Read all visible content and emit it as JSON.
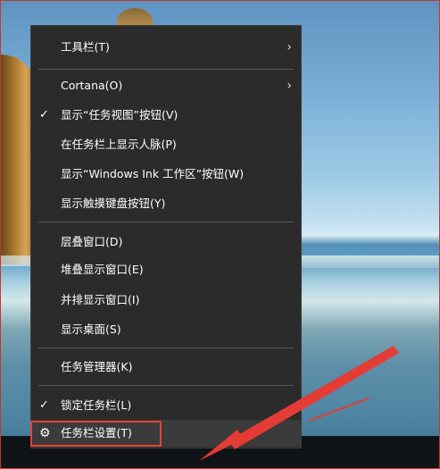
{
  "menu": {
    "items": [
      {
        "label": "工具栏(T)",
        "submenu": true
      },
      {
        "label": "Cortana(O)",
        "submenu": true
      },
      {
        "label": "显示“任务视图”按钮(V)",
        "checked": true
      },
      {
        "label": "在任务栏上显示人脉(P)"
      },
      {
        "label": "显示“Windows Ink 工作区”按钮(W)"
      },
      {
        "label": "显示触摸键盘按钮(Y)"
      },
      {
        "label": "层叠窗口(D)"
      },
      {
        "label": "堆叠显示窗口(E)"
      },
      {
        "label": "并排显示窗口(I)"
      },
      {
        "label": "显示桌面(S)"
      },
      {
        "label": "任务管理器(K)"
      },
      {
        "label": "锁定任务栏(L)",
        "checked": true
      },
      {
        "label": "任务栏设置(T)",
        "icon": "gear-icon"
      }
    ]
  },
  "colors": {
    "menu_bg": "#2b2b2b",
    "highlight": "#e8403a",
    "arrow": "#e53b35"
  },
  "icons": {
    "submenu": "chevron-right-icon",
    "check": "checkmark-icon",
    "settings": "gear-icon"
  }
}
